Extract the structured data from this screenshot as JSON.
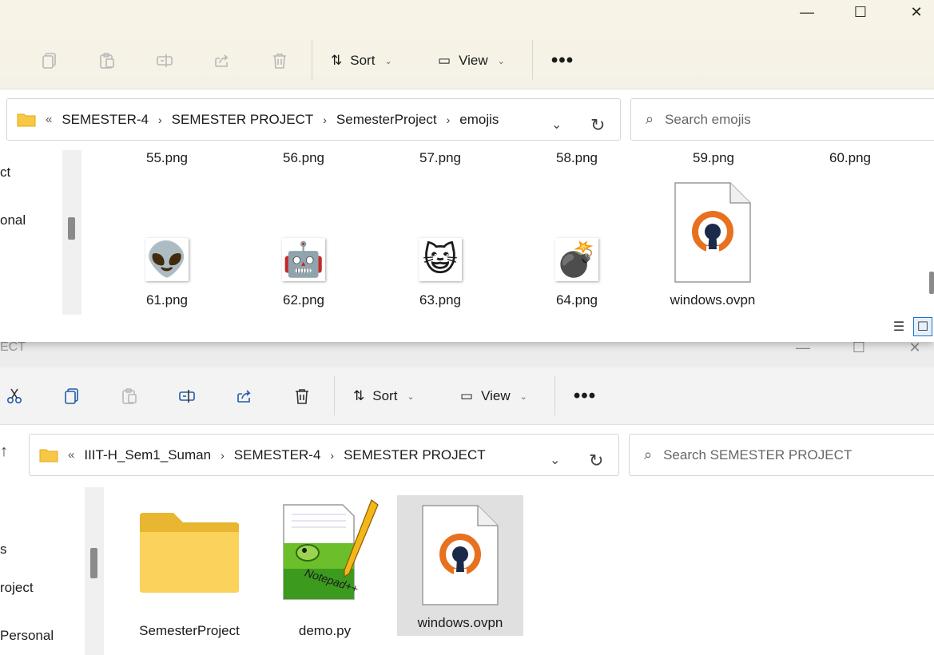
{
  "window_top": {
    "caption": {
      "minimize": "—",
      "maximize": "☐",
      "close": "✕"
    },
    "toolbar": {
      "sort_label": "Sort",
      "view_label": "View",
      "more_label": "•••"
    },
    "address": {
      "overflow": "«",
      "crumbs": [
        "SEMESTER-4",
        "SEMESTER PROJECT",
        "SemesterProject",
        "emojis"
      ]
    },
    "search": {
      "placeholder": "Search emojis"
    },
    "nav": {
      "items": [
        "ct",
        "onal"
      ]
    },
    "files_row1": [
      "55.png",
      "56.png",
      "57.png",
      "58.png",
      "59.png",
      "60.png"
    ],
    "files_row2": [
      {
        "name": "61.png",
        "icon": "👽"
      },
      {
        "name": "62.png",
        "icon": "🤖"
      },
      {
        "name": "63.png",
        "icon": "😺"
      },
      {
        "name": "64.png",
        "icon": "💣"
      },
      {
        "name": "windows.ovpn",
        "icon": "openvpn-file-icon"
      }
    ]
  },
  "window_bottom": {
    "title_fragment": "ECT",
    "caption": {
      "minimize": "—",
      "maximize": "☐",
      "close": "✕"
    },
    "toolbar": {
      "sort_label": "Sort",
      "view_label": "View",
      "more_label": "•••"
    },
    "up_arrow": "↑",
    "address": {
      "overflow": "«",
      "crumbs": [
        "IIIT-H_Sem1_Suman",
        "SEMESTER-4",
        "SEMESTER PROJECT"
      ]
    },
    "search": {
      "placeholder": "Search SEMESTER PROJECT"
    },
    "nav": {
      "items": [
        "s",
        "roject",
        "Personal"
      ]
    },
    "files": [
      {
        "name": "SemesterProject",
        "icon": "folder-icon"
      },
      {
        "name": "demo.py",
        "icon": "notepad-plus-plus-file-icon"
      },
      {
        "name": "windows.ovpn",
        "icon": "openvpn-file-icon",
        "selected": true
      }
    ]
  },
  "colors": {
    "openvpn_orange": "#e8711f",
    "openvpn_navy": "#1c2a4a",
    "folder_yellow": "#f7c843",
    "accent": "#1a73c8"
  }
}
